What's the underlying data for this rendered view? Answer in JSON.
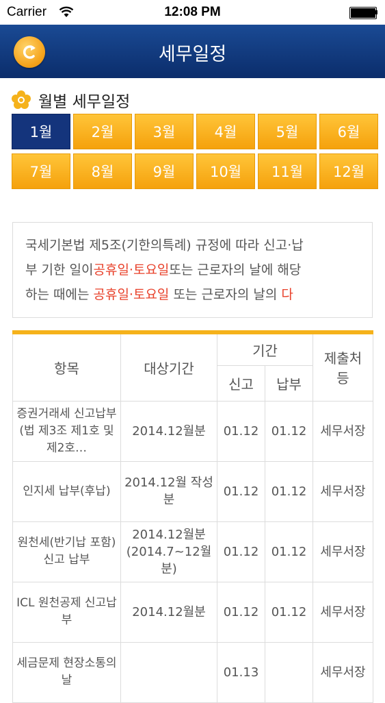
{
  "status_bar": {
    "carrier": "Carrier",
    "time": "12:08 PM"
  },
  "header": {
    "title": "세무일정",
    "back_icon": "refresh-back-icon"
  },
  "month_section": {
    "title": "월별 세무일정",
    "months": [
      "1월",
      "2월",
      "3월",
      "4월",
      "5월",
      "6월",
      "7월",
      "8월",
      "9월",
      "10월",
      "11월",
      "12월"
    ],
    "selected": "1월"
  },
  "notice": {
    "line1": "국세기본법 제5조(기한의특례) 규정에 따라 신고·납",
    "line2_a": "부 기한 일이",
    "line2_b": "공휴일·토요일",
    "line2_c": "또는 근로자의 날에 해당",
    "line3_a": "하는 때에는 ",
    "line3_b": "공휴일·토요일",
    "line3_c": " 또는 근로자의 날의 ",
    "line3_d": "다"
  },
  "table": {
    "headers": {
      "item": "항목",
      "target": "대상기간",
      "period": "기간",
      "report": "신고",
      "payment": "납부",
      "submit": "제출처 등"
    },
    "rows": [
      {
        "item": "증권거래세 신고납부(법 제3조 제1호 및 제2호…",
        "target": "2014.12월분",
        "report": "01.12",
        "payment": "01.12",
        "submit": "세무서장"
      },
      {
        "item": "인지세 납부(후납)",
        "target": "2014.12월 작성분",
        "report": "01.12",
        "payment": "01.12",
        "submit": "세무서장"
      },
      {
        "item": "원천세(반기납 포함) 신고 납부",
        "target": "2014.12월분 (2014.7~12월분)",
        "report": "01.12",
        "payment": "01.12",
        "submit": "세무서장"
      },
      {
        "item": "ICL 원천공제 신고납부",
        "target": "2014.12월분",
        "report": "01.12",
        "payment": "01.12",
        "submit": "세무서장"
      },
      {
        "item": "세금문제 현장소통의 날",
        "target": "",
        "report": "01.13",
        "payment": "",
        "submit": "세무서장"
      }
    ]
  },
  "colors": {
    "header": "#0b2d6b",
    "accent": "#f5a10c",
    "selected_month": "#14347c",
    "highlight": "#e8402a"
  }
}
